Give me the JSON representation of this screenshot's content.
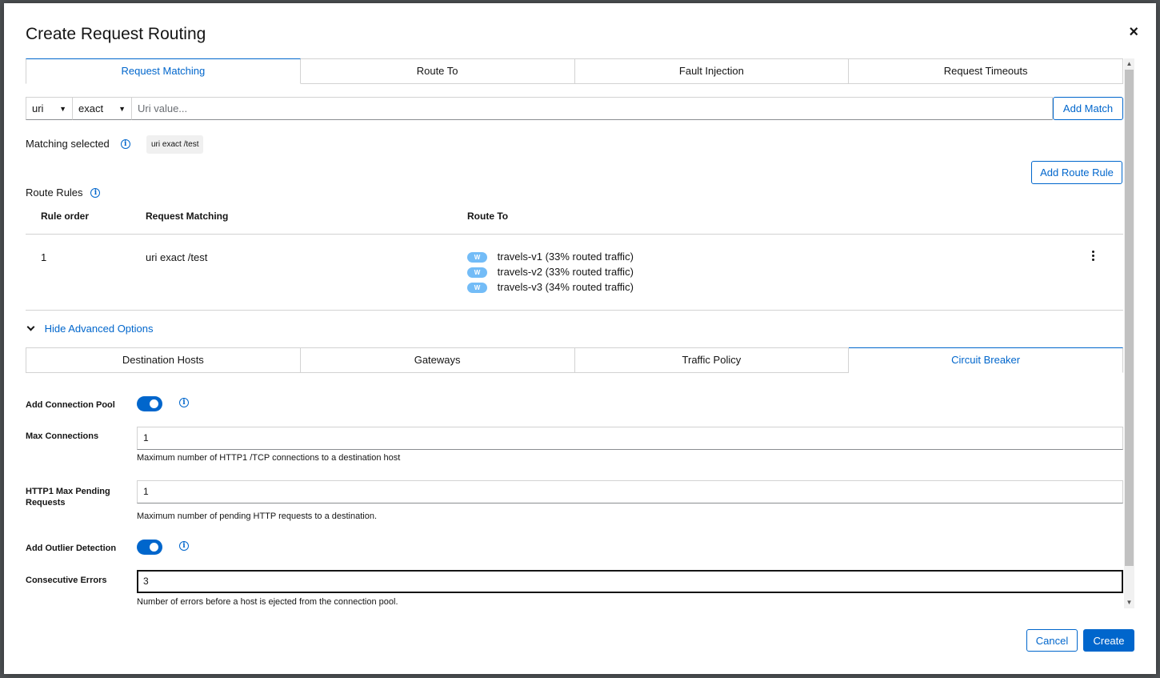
{
  "modal": {
    "title": "Create Request Routing",
    "close_glyph": "×"
  },
  "top_tabs": [
    {
      "label": "Request Matching",
      "active": true
    },
    {
      "label": "Route To",
      "active": false
    },
    {
      "label": "Fault Injection",
      "active": false
    },
    {
      "label": "Request Timeouts",
      "active": false
    }
  ],
  "matching": {
    "field_select": "uri",
    "operator_select": "exact",
    "value_placeholder": "Uri value...",
    "add_match_label": "Add Match",
    "selected_label": "Matching selected",
    "selected_chip": "uri exact /test"
  },
  "route_rules": {
    "add_rule_label": "Add Route Rule",
    "title": "Route Rules",
    "columns": [
      "Rule order",
      "Request Matching",
      "Route To"
    ],
    "rows": [
      {
        "order": "1",
        "matching": "uri exact /test",
        "routes": [
          {
            "badge": "W",
            "text": "travels-v1 (33% routed traffic)"
          },
          {
            "badge": "W",
            "text": "travels-v2 (33% routed traffic)"
          },
          {
            "badge": "W",
            "text": "travels-v3 (34% routed traffic)"
          }
        ]
      }
    ]
  },
  "advanced": {
    "toggle_label": "Hide Advanced Options"
  },
  "advanced_tabs": [
    {
      "label": "Destination Hosts",
      "active": false
    },
    {
      "label": "Gateways",
      "active": false
    },
    {
      "label": "Traffic Policy",
      "active": false
    },
    {
      "label": "Circuit Breaker",
      "active": true
    }
  ],
  "circuit_breaker": {
    "connection_pool_label": "Add Connection Pool",
    "connection_pool_on": true,
    "max_connections_label": "Max Connections",
    "max_connections_value": "1",
    "max_connections_help": "Maximum number of HTTP1 /TCP connections to a destination host",
    "http1_pending_label_1": "HTTP1 Max Pending",
    "http1_pending_label_2": "Requests",
    "http1_pending_value": "1",
    "http1_pending_help": "Maximum number of pending HTTP requests to a destination.",
    "outlier_label": "Add Outlier Detection",
    "outlier_on": true,
    "consecutive_errors_label": "Consecutive Errors",
    "consecutive_errors_value": "3",
    "consecutive_errors_help": "Number of errors before a host is ejected from the connection pool."
  },
  "footer": {
    "cancel_label": "Cancel",
    "create_label": "Create"
  },
  "colors": {
    "accent": "#0066cc",
    "badge": "#73bcf7",
    "overlay": "#4f5255"
  }
}
